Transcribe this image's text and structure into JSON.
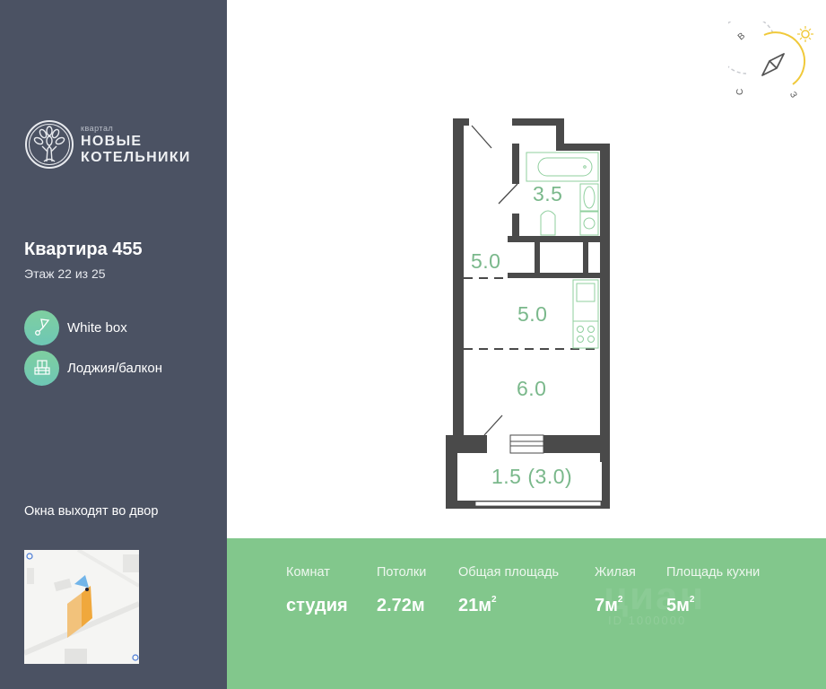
{
  "brand": {
    "small": "квартал",
    "line1": "НОВЫЕ",
    "line2": "КОТЕЛЬНИКИ",
    "icon": "tree-logo-icon"
  },
  "apartment": {
    "title": "Квартира 455",
    "floor": "Этаж 22 из 25"
  },
  "features": [
    {
      "icon": "trowel-icon",
      "label": "White box"
    },
    {
      "icon": "balcony-icon",
      "label": "Лоджия/балкон"
    }
  ],
  "windows_text": "Окна выходят во двор",
  "compass": {
    "labels": [
      "В",
      "С",
      "З"
    ],
    "icon": "compass-icon",
    "sun_icon": "sun-icon"
  },
  "plan": {
    "rooms": [
      {
        "id": "bathroom",
        "area": "3.5"
      },
      {
        "id": "hall",
        "area": "5.0"
      },
      {
        "id": "kitchen",
        "area": "5.0"
      },
      {
        "id": "living",
        "area": "6.0"
      },
      {
        "id": "balcony",
        "area": "1.5 (3.0)"
      }
    ]
  },
  "stats": [
    {
      "label": "Комнат",
      "value": "студия",
      "sup": ""
    },
    {
      "label": "Потолки",
      "value": "2.72м",
      "sup": ""
    },
    {
      "label": "Общая площадь",
      "value": "21м",
      "sup": "2"
    },
    {
      "label": "Жилая",
      "value": "7м",
      "sup": "2"
    },
    {
      "label": "Площадь кухни",
      "value": "5м",
      "sup": "2"
    }
  ],
  "watermark": {
    "text": "циан",
    "sub": "ID 1000000"
  },
  "colors": {
    "sidebar": "#4b5263",
    "stats_bg": "#82c78c",
    "accent_green": "#7ab88b",
    "wall": "#4a4a4a",
    "sun": "#f0c93a"
  }
}
